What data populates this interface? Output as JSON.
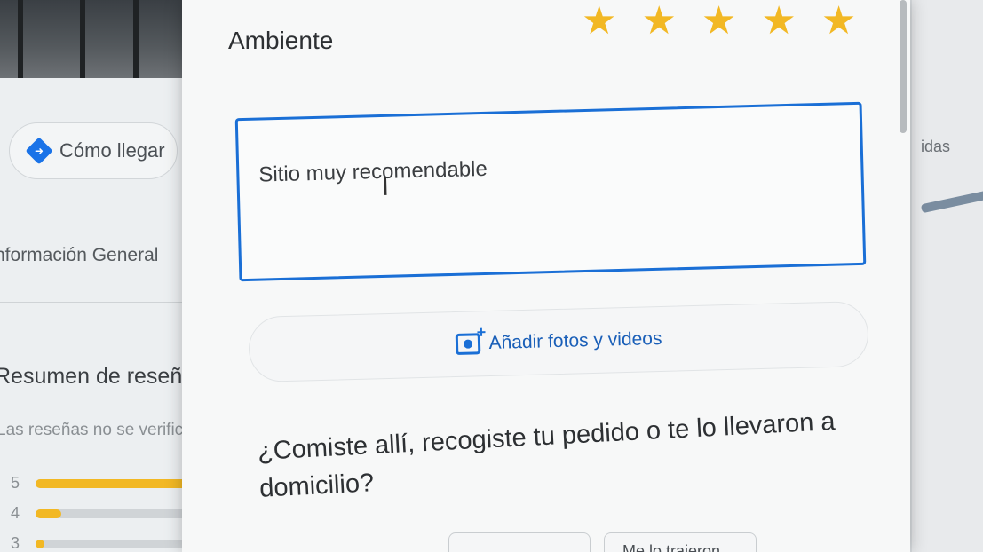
{
  "background_left": {
    "directions_label": "Cómo llegar",
    "info_general": "nformación General",
    "reviews_title": "Resumen de reseñ",
    "reviews_note": "Las reseñas no se verific",
    "ratings": [
      {
        "stars": "5",
        "fraction": 0.95
      },
      {
        "stars": "4",
        "fraction": 0.15
      },
      {
        "stars": "3",
        "fraction": 0.05
      }
    ]
  },
  "background_right": {
    "map_label": "idas"
  },
  "dialog": {
    "ambience_label": "Ambiente",
    "ambience_rating": 5,
    "star_glyph": "★",
    "review_text": "Sitio muy recomendable",
    "cursor_glyph": "I",
    "add_media_label": "Añadir fotos y videos",
    "camera_plus": "+",
    "question": "¿Comiste allí, recogiste tu pedido o te lo llevaron a domicilio?",
    "chip_2": "Me lo trajeron"
  },
  "colors": {
    "accent": "#1a6fd6",
    "star": "#f2b824"
  }
}
